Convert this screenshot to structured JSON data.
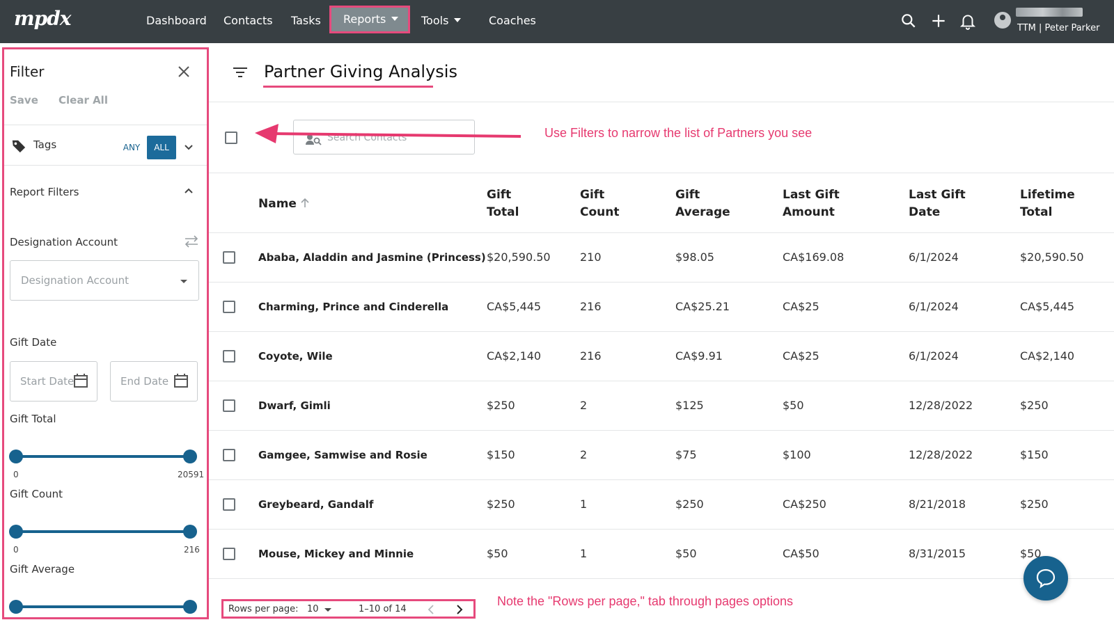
{
  "nav": {
    "logo": "mpdx",
    "items": [
      {
        "label": "Dashboard"
      },
      {
        "label": "Contacts"
      },
      {
        "label": "Tasks"
      },
      {
        "label": "Reports"
      },
      {
        "label": "Tools"
      },
      {
        "label": "Coaches"
      }
    ],
    "user_label": "TTM | Peter Parker",
    "icons": [
      "search-icon",
      "plus-icon",
      "bell-icon",
      "account-icon"
    ]
  },
  "filter": {
    "title": "Filter",
    "save": "Save",
    "clear_all": "Clear All",
    "tags_label": "Tags",
    "any": "ANY",
    "all": "ALL",
    "report_filters": "Report Filters",
    "designation_account_label": "Designation Account",
    "designation_account_placeholder": "Designation Account",
    "gift_date_label": "Gift Date",
    "start_date": "Start Date",
    "end_date": "End Date",
    "gift_total": {
      "label": "Gift Total",
      "min": "0",
      "max": "20591"
    },
    "gift_count": {
      "label": "Gift Count",
      "min": "0",
      "max": "216"
    },
    "gift_average": {
      "label": "Gift Average"
    }
  },
  "main": {
    "title": "Partner Giving Analysis",
    "search_placeholder": "Search Contacts",
    "annotation_filters": "Use Filters to narrow the list of Partners you see",
    "annotation_pager": "Note the \"Rows per page,\" tab through pages options",
    "columns": [
      {
        "line1": "Name",
        "line2": ""
      },
      {
        "line1": "Gift",
        "line2": "Total"
      },
      {
        "line1": "Gift",
        "line2": "Count"
      },
      {
        "line1": "Gift",
        "line2": "Average"
      },
      {
        "line1": "Last Gift",
        "line2": "Amount"
      },
      {
        "line1": "Last Gift",
        "line2": "Date"
      },
      {
        "line1": "Lifetime",
        "line2": "Total"
      }
    ],
    "rows": [
      {
        "name": "Ababa, Aladdin and Jasmine (Princess)",
        "gift_total": "$20,590.50",
        "gift_count": "210",
        "gift_average": "$98.05",
        "last_gift_amount": "CA$169.08",
        "last_gift_date": "6/1/2024",
        "lifetime_total": "$20,590.50"
      },
      {
        "name": "Charming, Prince and Cinderella",
        "gift_total": "CA$5,445",
        "gift_count": "216",
        "gift_average": "CA$25.21",
        "last_gift_amount": "CA$25",
        "last_gift_date": "6/1/2024",
        "lifetime_total": "CA$5,445"
      },
      {
        "name": "Coyote, Wile",
        "gift_total": "CA$2,140",
        "gift_count": "216",
        "gift_average": "CA$9.91",
        "last_gift_amount": "CA$25",
        "last_gift_date": "6/1/2024",
        "lifetime_total": "CA$2,140"
      },
      {
        "name": "Dwarf, Gimli",
        "gift_total": "$250",
        "gift_count": "2",
        "gift_average": "$125",
        "last_gift_amount": "$50",
        "last_gift_date": "12/28/2022",
        "lifetime_total": "$250"
      },
      {
        "name": "Gamgee, Samwise and Rosie",
        "gift_total": "$150",
        "gift_count": "2",
        "gift_average": "$75",
        "last_gift_amount": "$100",
        "last_gift_date": "12/28/2022",
        "lifetime_total": "$150"
      },
      {
        "name": "Greybeard, Gandalf",
        "gift_total": "$250",
        "gift_count": "1",
        "gift_average": "$250",
        "last_gift_amount": "CA$250",
        "last_gift_date": "8/21/2018",
        "lifetime_total": "$250"
      },
      {
        "name": "Mouse, Mickey and Minnie",
        "gift_total": "$50",
        "gift_count": "1",
        "gift_average": "$50",
        "last_gift_amount": "CA$50",
        "last_gift_date": "8/31/2015",
        "lifetime_total": "$50"
      }
    ],
    "pager": {
      "rows_per_page_label": "Rows per page:",
      "rows_per_page_value": "10",
      "range": "1–10 of 14"
    }
  },
  "colors": {
    "nav_bg": "#383f43",
    "accent": "#17628e",
    "annotation": "#e6396f"
  }
}
